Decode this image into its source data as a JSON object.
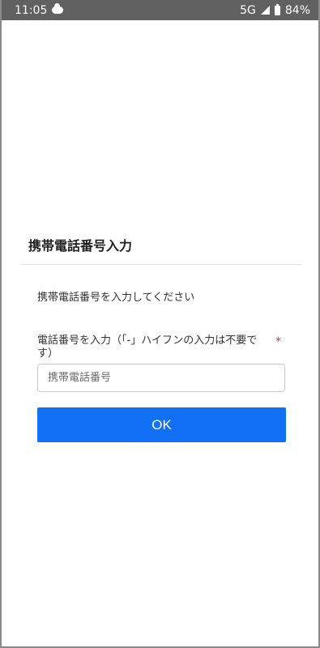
{
  "status_bar": {
    "time": "11:05",
    "network": "5G",
    "battery": "84%"
  },
  "dialog": {
    "title": "携帯電話番号入力",
    "instruction": "携帯電話番号を入力してください",
    "field_label": "電話番号を入力（「-」ハイフンの入力は不要です）",
    "required_mark": "*",
    "phone_placeholder": "携帯電話番号",
    "phone_value": "",
    "ok_label": "OK"
  },
  "colors": {
    "status_bar_bg": "#616161",
    "accent": "#1170f3",
    "required": "#d9342b"
  }
}
